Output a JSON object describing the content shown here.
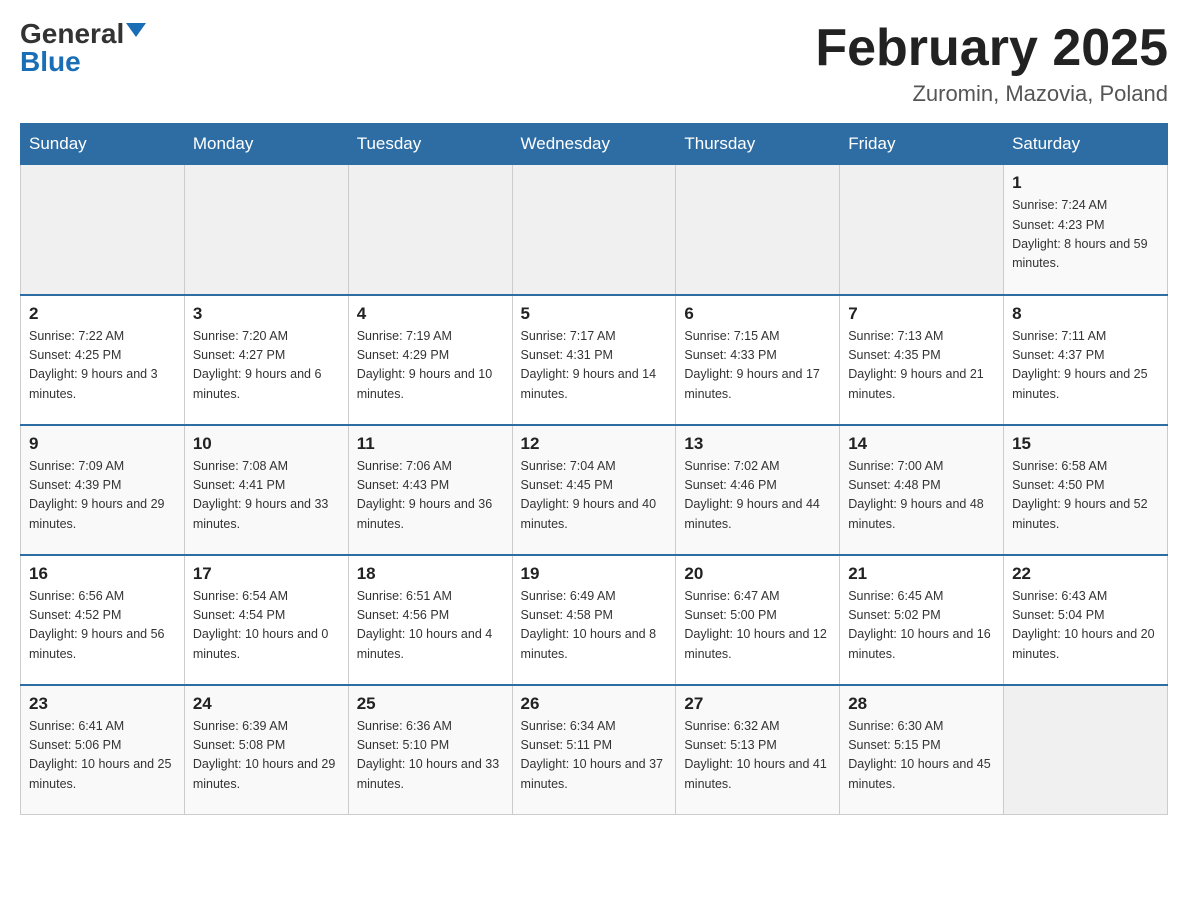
{
  "header": {
    "logo_general": "General",
    "logo_blue": "Blue",
    "month_title": "February 2025",
    "location": "Zuromin, Mazovia, Poland"
  },
  "weekdays": [
    "Sunday",
    "Monday",
    "Tuesday",
    "Wednesday",
    "Thursday",
    "Friday",
    "Saturday"
  ],
  "weeks": [
    [
      {
        "day": "",
        "sunrise": "",
        "sunset": "",
        "daylight": ""
      },
      {
        "day": "",
        "sunrise": "",
        "sunset": "",
        "daylight": ""
      },
      {
        "day": "",
        "sunrise": "",
        "sunset": "",
        "daylight": ""
      },
      {
        "day": "",
        "sunrise": "",
        "sunset": "",
        "daylight": ""
      },
      {
        "day": "",
        "sunrise": "",
        "sunset": "",
        "daylight": ""
      },
      {
        "day": "",
        "sunrise": "",
        "sunset": "",
        "daylight": ""
      },
      {
        "day": "1",
        "sunrise": "Sunrise: 7:24 AM",
        "sunset": "Sunset: 4:23 PM",
        "daylight": "Daylight: 8 hours and 59 minutes."
      }
    ],
    [
      {
        "day": "2",
        "sunrise": "Sunrise: 7:22 AM",
        "sunset": "Sunset: 4:25 PM",
        "daylight": "Daylight: 9 hours and 3 minutes."
      },
      {
        "day": "3",
        "sunrise": "Sunrise: 7:20 AM",
        "sunset": "Sunset: 4:27 PM",
        "daylight": "Daylight: 9 hours and 6 minutes."
      },
      {
        "day": "4",
        "sunrise": "Sunrise: 7:19 AM",
        "sunset": "Sunset: 4:29 PM",
        "daylight": "Daylight: 9 hours and 10 minutes."
      },
      {
        "day": "5",
        "sunrise": "Sunrise: 7:17 AM",
        "sunset": "Sunset: 4:31 PM",
        "daylight": "Daylight: 9 hours and 14 minutes."
      },
      {
        "day": "6",
        "sunrise": "Sunrise: 7:15 AM",
        "sunset": "Sunset: 4:33 PM",
        "daylight": "Daylight: 9 hours and 17 minutes."
      },
      {
        "day": "7",
        "sunrise": "Sunrise: 7:13 AM",
        "sunset": "Sunset: 4:35 PM",
        "daylight": "Daylight: 9 hours and 21 minutes."
      },
      {
        "day": "8",
        "sunrise": "Sunrise: 7:11 AM",
        "sunset": "Sunset: 4:37 PM",
        "daylight": "Daylight: 9 hours and 25 minutes."
      }
    ],
    [
      {
        "day": "9",
        "sunrise": "Sunrise: 7:09 AM",
        "sunset": "Sunset: 4:39 PM",
        "daylight": "Daylight: 9 hours and 29 minutes."
      },
      {
        "day": "10",
        "sunrise": "Sunrise: 7:08 AM",
        "sunset": "Sunset: 4:41 PM",
        "daylight": "Daylight: 9 hours and 33 minutes."
      },
      {
        "day": "11",
        "sunrise": "Sunrise: 7:06 AM",
        "sunset": "Sunset: 4:43 PM",
        "daylight": "Daylight: 9 hours and 36 minutes."
      },
      {
        "day": "12",
        "sunrise": "Sunrise: 7:04 AM",
        "sunset": "Sunset: 4:45 PM",
        "daylight": "Daylight: 9 hours and 40 minutes."
      },
      {
        "day": "13",
        "sunrise": "Sunrise: 7:02 AM",
        "sunset": "Sunset: 4:46 PM",
        "daylight": "Daylight: 9 hours and 44 minutes."
      },
      {
        "day": "14",
        "sunrise": "Sunrise: 7:00 AM",
        "sunset": "Sunset: 4:48 PM",
        "daylight": "Daylight: 9 hours and 48 minutes."
      },
      {
        "day": "15",
        "sunrise": "Sunrise: 6:58 AM",
        "sunset": "Sunset: 4:50 PM",
        "daylight": "Daylight: 9 hours and 52 minutes."
      }
    ],
    [
      {
        "day": "16",
        "sunrise": "Sunrise: 6:56 AM",
        "sunset": "Sunset: 4:52 PM",
        "daylight": "Daylight: 9 hours and 56 minutes."
      },
      {
        "day": "17",
        "sunrise": "Sunrise: 6:54 AM",
        "sunset": "Sunset: 4:54 PM",
        "daylight": "Daylight: 10 hours and 0 minutes."
      },
      {
        "day": "18",
        "sunrise": "Sunrise: 6:51 AM",
        "sunset": "Sunset: 4:56 PM",
        "daylight": "Daylight: 10 hours and 4 minutes."
      },
      {
        "day": "19",
        "sunrise": "Sunrise: 6:49 AM",
        "sunset": "Sunset: 4:58 PM",
        "daylight": "Daylight: 10 hours and 8 minutes."
      },
      {
        "day": "20",
        "sunrise": "Sunrise: 6:47 AM",
        "sunset": "Sunset: 5:00 PM",
        "daylight": "Daylight: 10 hours and 12 minutes."
      },
      {
        "day": "21",
        "sunrise": "Sunrise: 6:45 AM",
        "sunset": "Sunset: 5:02 PM",
        "daylight": "Daylight: 10 hours and 16 minutes."
      },
      {
        "day": "22",
        "sunrise": "Sunrise: 6:43 AM",
        "sunset": "Sunset: 5:04 PM",
        "daylight": "Daylight: 10 hours and 20 minutes."
      }
    ],
    [
      {
        "day": "23",
        "sunrise": "Sunrise: 6:41 AM",
        "sunset": "Sunset: 5:06 PM",
        "daylight": "Daylight: 10 hours and 25 minutes."
      },
      {
        "day": "24",
        "sunrise": "Sunrise: 6:39 AM",
        "sunset": "Sunset: 5:08 PM",
        "daylight": "Daylight: 10 hours and 29 minutes."
      },
      {
        "day": "25",
        "sunrise": "Sunrise: 6:36 AM",
        "sunset": "Sunset: 5:10 PM",
        "daylight": "Daylight: 10 hours and 33 minutes."
      },
      {
        "day": "26",
        "sunrise": "Sunrise: 6:34 AM",
        "sunset": "Sunset: 5:11 PM",
        "daylight": "Daylight: 10 hours and 37 minutes."
      },
      {
        "day": "27",
        "sunrise": "Sunrise: 6:32 AM",
        "sunset": "Sunset: 5:13 PM",
        "daylight": "Daylight: 10 hours and 41 minutes."
      },
      {
        "day": "28",
        "sunrise": "Sunrise: 6:30 AM",
        "sunset": "Sunset: 5:15 PM",
        "daylight": "Daylight: 10 hours and 45 minutes."
      },
      {
        "day": "",
        "sunrise": "",
        "sunset": "",
        "daylight": ""
      }
    ]
  ]
}
